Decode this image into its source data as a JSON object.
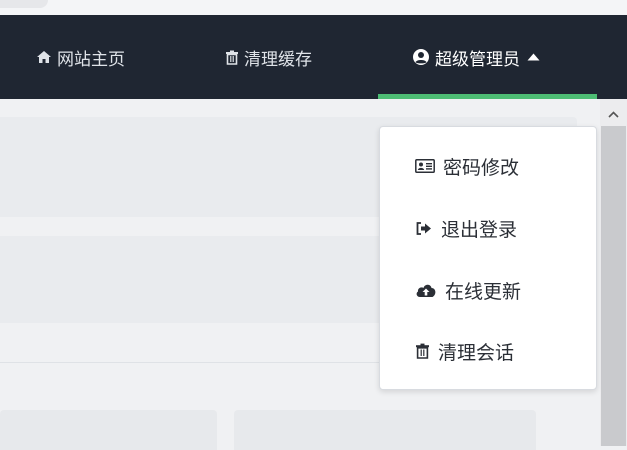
{
  "navbar": {
    "home_label": "网站主页",
    "cache_label": "清理缓存",
    "admin_label": "超级管理员",
    "accent_color": "#4dbd74",
    "background_color": "#1f2632"
  },
  "dropdown": {
    "items": [
      {
        "label": "密码修改",
        "icon": "id-card-icon"
      },
      {
        "label": "退出登录",
        "icon": "sign-out-icon"
      },
      {
        "label": "在线更新",
        "icon": "cloud-upload-icon"
      },
      {
        "label": "清理会话",
        "icon": "trash-icon"
      }
    ]
  },
  "icons": {
    "home": "home-icon",
    "cache": "trash-icon",
    "admin": "user-circle-icon",
    "caret": "caret-up-icon",
    "scroll_up": "chevron-up-icon"
  }
}
